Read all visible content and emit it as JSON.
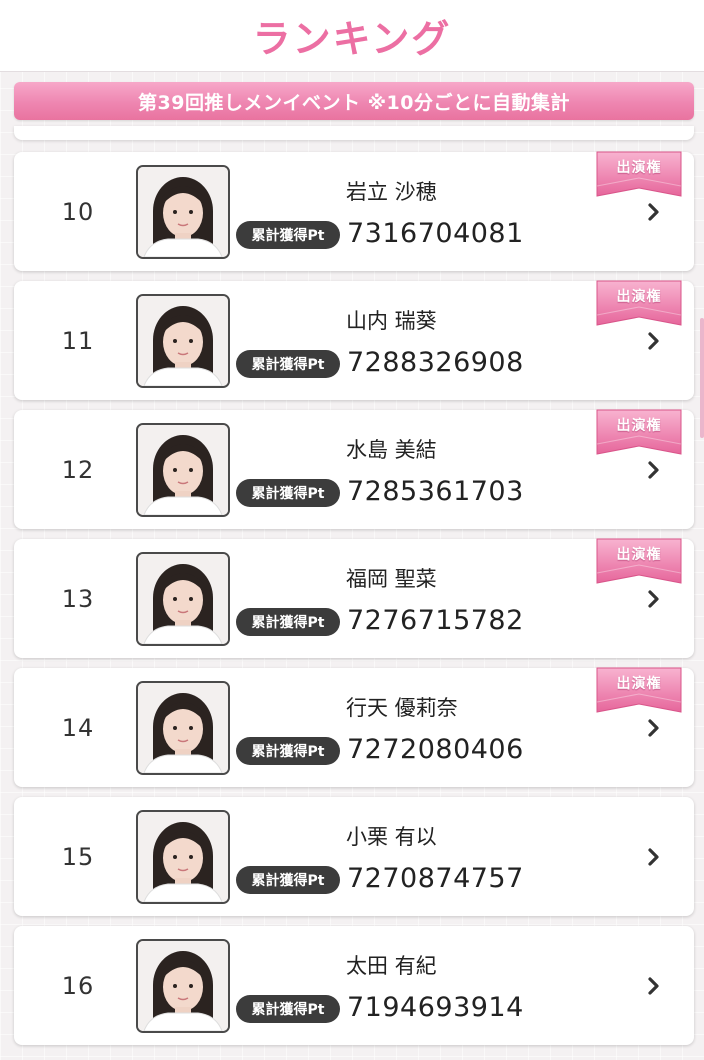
{
  "header": {
    "title": "ランキング"
  },
  "event_banner": {
    "text": "第39回推しメンイベント ※10分ごとに自動集計"
  },
  "ranking": {
    "pt_label": "累計獲得Pt",
    "ribbon_label": "出演権",
    "entries": [
      {
        "rank": "10",
        "name": "岩立 沙穂",
        "points": "7316704081",
        "has_ribbon": true
      },
      {
        "rank": "11",
        "name": "山内 瑞葵",
        "points": "7288326908",
        "has_ribbon": true
      },
      {
        "rank": "12",
        "name": "水島 美結",
        "points": "7285361703",
        "has_ribbon": true
      },
      {
        "rank": "13",
        "name": "福岡 聖菜",
        "points": "7276715782",
        "has_ribbon": true
      },
      {
        "rank": "14",
        "name": "行天 優莉奈",
        "points": "7272080406",
        "has_ribbon": true
      },
      {
        "rank": "15",
        "name": "小栗 有以",
        "points": "7270874757",
        "has_ribbon": false
      },
      {
        "rank": "16",
        "name": "太田 有紀",
        "points": "7194693914",
        "has_ribbon": false
      }
    ]
  },
  "colors": {
    "accent_pink": "#ec6fa3",
    "ribbon_pink": "#ef86b3",
    "badge_dark": "#3c3c3c"
  },
  "icons": {
    "ribbon": "award-ribbon-icon",
    "chevron": "chevron-right-icon",
    "photo": "member-photo"
  }
}
